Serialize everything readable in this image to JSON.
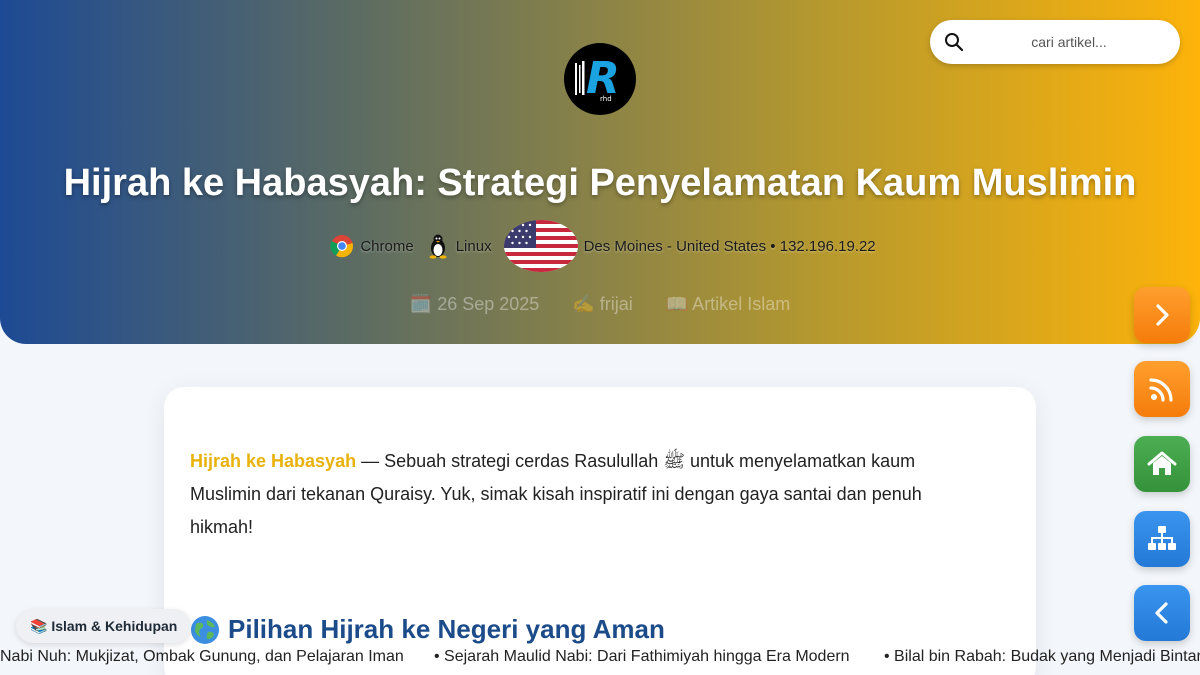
{
  "search": {
    "placeholder": "cari artikel..."
  },
  "logo": {
    "letter": "R",
    "text": "rhd"
  },
  "article": {
    "title": "Hijrah ke Habasyah: Strategi Penyelamatan Kaum Muslimin",
    "visitor": {
      "browser": "Chrome",
      "os": "Linux",
      "location": "Des Moines - United States • 132.196.19.22"
    },
    "date": "🗓️ 26 Sep 2025",
    "author": "✍️ frijai",
    "category": "📖 Artikel Islam",
    "intro_highlight": "Hijrah ke Habasyah",
    "intro_text": " — Sebuah strategi cerdas Rasulullah ﷺ untuk menyelamatkan kaum Muslimin dari tekanan Quraisy. Yuk, simak kisah inspiratif ini dengan gaya santai dan penuh hikmah!",
    "section_heading": "Pilihan Hijrah ke Negeri yang Aman",
    "section_icon": "globe-icon"
  },
  "category_chip": "📚 Islam & Kehidupan",
  "ticker": [
    "Nabi Nuh: Mukjizat, Ombak Gunung, dan Pelajaran Iman",
    "• Sejarah Maulid Nabi: Dari Fathimiyah hingga Era Modern",
    "• Bilal bin Rabah: Budak yang Menjadi Bintang"
  ],
  "floating_buttons": [
    {
      "name": "next-button",
      "icon": "chevron-right-icon",
      "color": "#fb8b16"
    },
    {
      "name": "rss-button",
      "icon": "rss-icon",
      "color": "#fb8b16"
    },
    {
      "name": "home-button",
      "icon": "home-icon",
      "color": "#3f9f46"
    },
    {
      "name": "sitemap-button",
      "icon": "sitemap-icon",
      "color": "#2f84e0"
    },
    {
      "name": "prev-button",
      "icon": "chevron-left-icon",
      "color": "#2f84e0"
    }
  ],
  "colors": {
    "hero_gradient_start": "#1d4a94",
    "hero_gradient_end": "#fdb30a",
    "highlight": "#e9b20a",
    "heading": "#1c4b8a"
  }
}
